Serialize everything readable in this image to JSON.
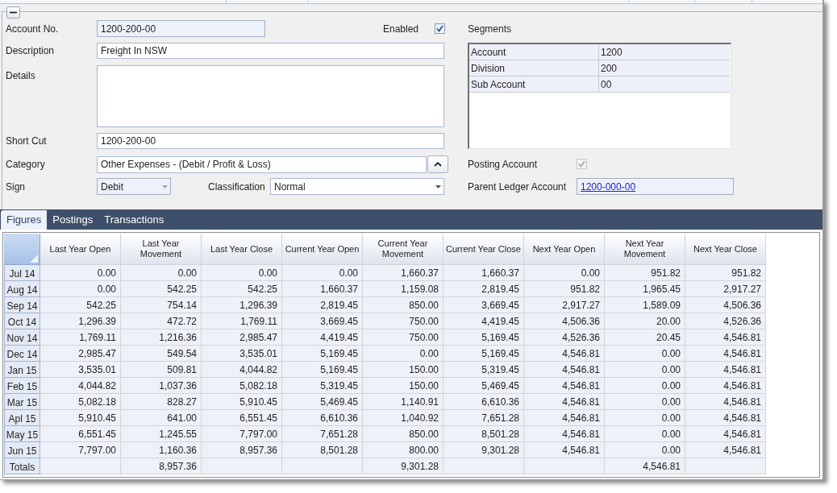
{
  "group": {
    "expanded": true
  },
  "form": {
    "account_no": {
      "label": "Account No.",
      "value": "1200-200-00",
      "read_only": true
    },
    "enabled": {
      "label": "Enabled",
      "checked": true,
      "disabled": false
    },
    "description": {
      "label": "Description",
      "value": "Freight In NSW",
      "read_only": false
    },
    "details": {
      "label": "Details",
      "read_only": false
    },
    "short_cut": {
      "label": "Short Cut",
      "value": "1200-200-00",
      "read_only": false
    },
    "category": {
      "label": "Category",
      "value": "Other Expenses - (Debit / Profit & Loss)",
      "read_only": false
    },
    "sign": {
      "label": "Sign",
      "value": "Debit",
      "read_only": true
    },
    "classification": {
      "label": "Classification",
      "value": "Normal",
      "read_only": false
    }
  },
  "segments": {
    "label": "Segments",
    "rows": [
      {
        "name": "Account",
        "value": "1200"
      },
      {
        "name": "Division",
        "value": "200"
      },
      {
        "name": "Sub Account",
        "value": "00"
      }
    ]
  },
  "posting_account": {
    "label": "Posting Account",
    "checked": true,
    "disabled": true
  },
  "parent_ledger_account": {
    "label": "Parent Ledger Account",
    "value": "1200-000-00",
    "read_only": true
  },
  "tabs": [
    {
      "label": "Figures",
      "selected": true
    },
    {
      "label": "Postings",
      "selected": false
    },
    {
      "label": "Transactions",
      "selected": false
    }
  ],
  "figures_table": {
    "columns": [
      "Last Year Open",
      "Last Year Movement",
      "Last Year Close",
      "Current Year Open",
      "Current Year Movement",
      "Current Year Close",
      "Next Year Open",
      "Next Year Movement",
      "Next Year Close"
    ],
    "rows": [
      {
        "period": "Jul 14",
        "cells": [
          "0.00",
          "0.00",
          "0.00",
          "0.00",
          "1,660.37",
          "1,660.37",
          "0.00",
          "951.82",
          "951.82"
        ]
      },
      {
        "period": "Aug 14",
        "cells": [
          "0.00",
          "542.25",
          "542.25",
          "1,660.37",
          "1,159.08",
          "2,819.45",
          "951.82",
          "1,965.45",
          "2,917.27"
        ]
      },
      {
        "period": "Sep 14",
        "cells": [
          "542.25",
          "754.14",
          "1,296.39",
          "2,819.45",
          "850.00",
          "3,669.45",
          "2,917.27",
          "1,589.09",
          "4,506.36"
        ]
      },
      {
        "period": "Oct 14",
        "cells": [
          "1,296.39",
          "472.72",
          "1,769.11",
          "3,669.45",
          "750.00",
          "4,419.45",
          "4,506.36",
          "20.00",
          "4,526.36"
        ]
      },
      {
        "period": "Nov 14",
        "cells": [
          "1,769.11",
          "1,216.36",
          "2,985.47",
          "4,419.45",
          "750.00",
          "5,169.45",
          "4,526.36",
          "20.45",
          "4,546.81"
        ]
      },
      {
        "period": "Dec 14",
        "cells": [
          "2,985.47",
          "549.54",
          "3,535.01",
          "5,169.45",
          "0.00",
          "5,169.45",
          "4,546.81",
          "0.00",
          "4,546.81"
        ]
      },
      {
        "period": "Jan 15",
        "cells": [
          "3,535.01",
          "509.81",
          "4,044.82",
          "5,169.45",
          "150.00",
          "5,319.45",
          "4,546.81",
          "0.00",
          "4,546.81"
        ]
      },
      {
        "period": "Feb 15",
        "cells": [
          "4,044.82",
          "1,037.36",
          "5,082.18",
          "5,319.45",
          "150.00",
          "5,469.45",
          "4,546.81",
          "0.00",
          "4,546.81"
        ]
      },
      {
        "period": "Mar 15",
        "cells": [
          "5,082.18",
          "828.27",
          "5,910.45",
          "5,469.45",
          "1,140.91",
          "6,610.36",
          "4,546.81",
          "0.00",
          "4,546.81"
        ]
      },
      {
        "period": "Apl 15",
        "cells": [
          "5,910.45",
          "641.00",
          "6,551.45",
          "6,610.36",
          "1,040.92",
          "7,651.28",
          "4,546.81",
          "0.00",
          "4,546.81"
        ]
      },
      {
        "period": "May 15",
        "cells": [
          "6,551.45",
          "1,245.55",
          "7,797.00",
          "7,651.28",
          "850.00",
          "8,501.28",
          "4,546.81",
          "0.00",
          "4,546.81"
        ]
      },
      {
        "period": "Jun 15",
        "cells": [
          "7,797.00",
          "1,160.36",
          "8,957.36",
          "8,501.28",
          "800.00",
          "9,301.28",
          "4,546.81",
          "0.00",
          "4,546.81"
        ]
      }
    ],
    "totals": {
      "label": "Totals",
      "cells": [
        null,
        "8,957.36",
        null,
        null,
        "9,301.28",
        null,
        null,
        "4,546.81",
        null
      ]
    }
  }
}
